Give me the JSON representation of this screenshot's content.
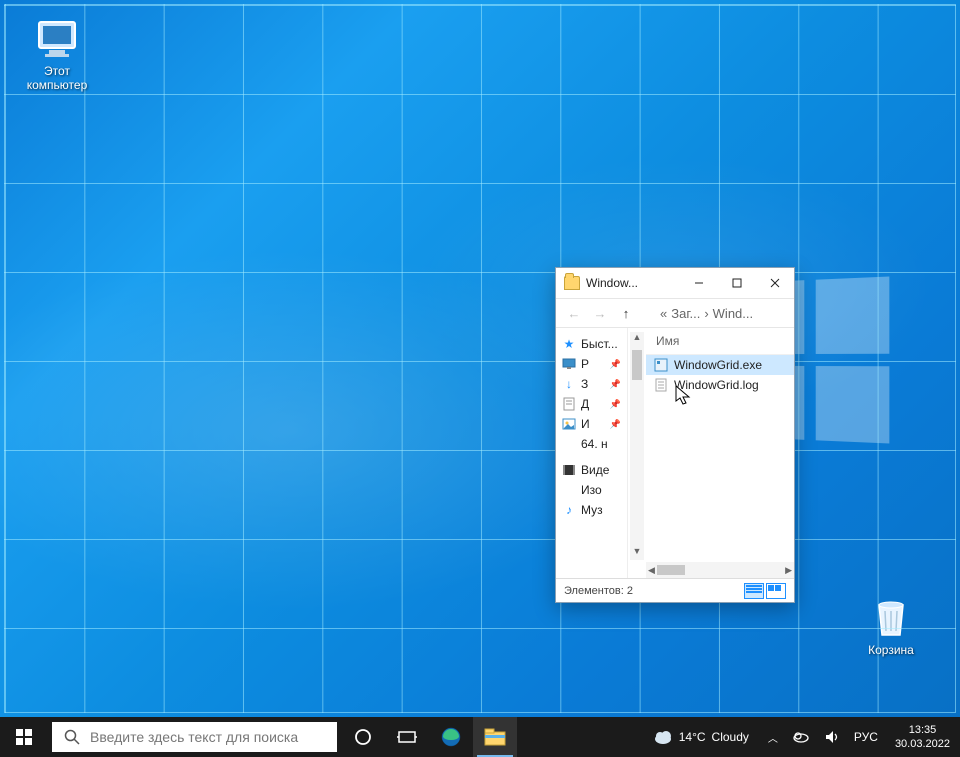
{
  "desktop": {
    "icons": {
      "this_pc": "Этот\nкомпьютер",
      "recycle_bin": "Корзина"
    }
  },
  "explorer": {
    "title": "Window...",
    "breadcrumbs": {
      "prefix": "«",
      "a": "Заг...",
      "sep": "›",
      "b": "Wind..."
    },
    "column_header": "Имя",
    "sidebar": {
      "quick_access": "Быст...",
      "items": [
        {
          "label": "Р",
          "icon": "desktop"
        },
        {
          "label": "З",
          "icon": "downloads"
        },
        {
          "label": "Д",
          "icon": "documents"
        },
        {
          "label": "И",
          "icon": "pictures"
        }
      ],
      "extra": "64. н",
      "below": [
        {
          "label": "Виде",
          "icon": "videos"
        },
        {
          "label": "Изо",
          "icon": "folder"
        },
        {
          "label": "Муз",
          "icon": "music"
        }
      ]
    },
    "files": [
      {
        "name": "WindowGrid.exe",
        "selected": true,
        "icon": "exe"
      },
      {
        "name": "WindowGrid.log",
        "selected": false,
        "icon": "log"
      }
    ],
    "status": "Элементов: 2"
  },
  "taskbar": {
    "search_placeholder": "Введите здесь текст для поиска",
    "weather": {
      "temp": "14°C",
      "cond": "Cloudy"
    },
    "lang": "РУС",
    "time": "13:35",
    "date": "30.03.2022"
  }
}
